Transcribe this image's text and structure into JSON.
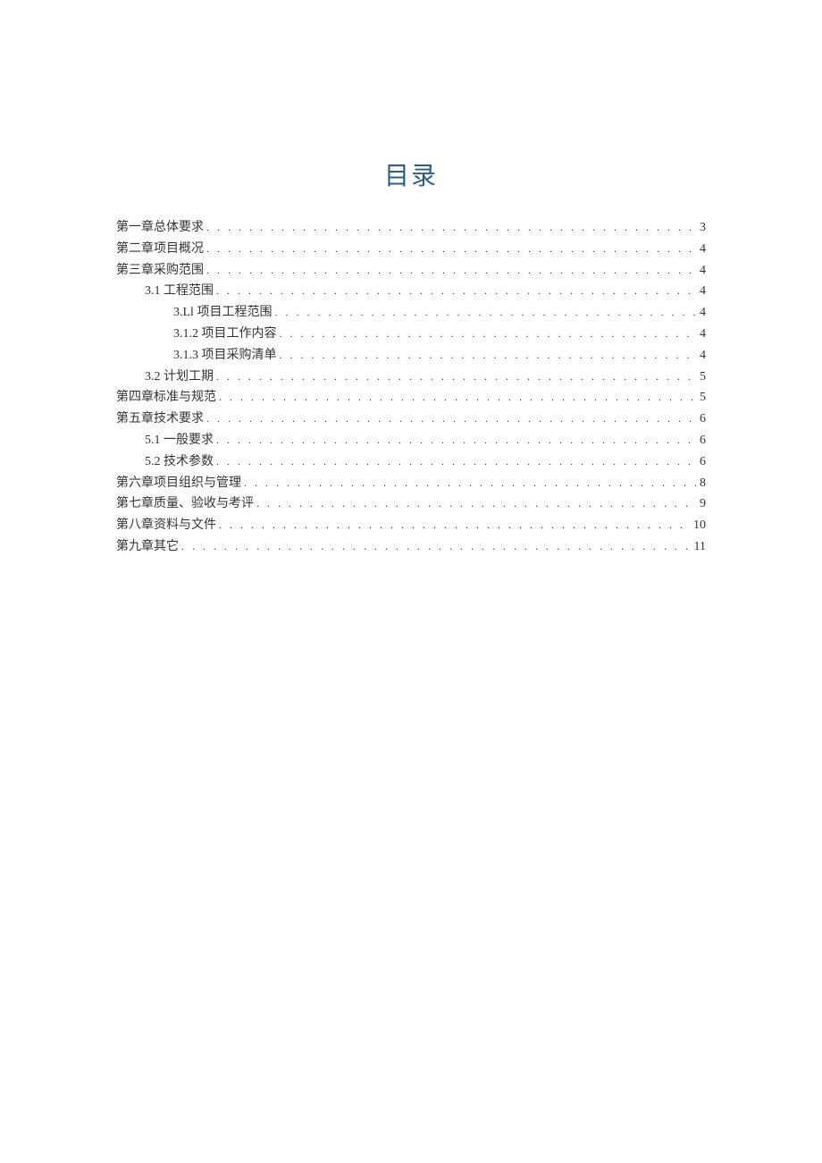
{
  "title": "目录",
  "entries": [
    {
      "label": "第一章总体要求",
      "page": "3",
      "level": 0
    },
    {
      "label": "第二章项目概况",
      "page": "4",
      "level": 0
    },
    {
      "label": "第三章采购范围",
      "page": "4",
      "level": 0
    },
    {
      "label": "3.1 工程范围",
      "page": "4",
      "level": 1
    },
    {
      "label": "3.Ll 项目工程范围",
      "page": "4",
      "level": 2
    },
    {
      "label": "3.1.2 项目工作内容",
      "page": "4",
      "level": 2
    },
    {
      "label": "3.1.3 项目采购清单",
      "page": "4",
      "level": 2
    },
    {
      "label": "3.2 计划工期",
      "page": "5",
      "level": 1
    },
    {
      "label": "第四章标准与规范",
      "page": "5",
      "level": 0
    },
    {
      "label": "第五章技术要求",
      "page": "6",
      "level": 0
    },
    {
      "label": "5.1 一般要求",
      "page": "6",
      "level": 1
    },
    {
      "label": "5.2 技术参数",
      "page": "6",
      "level": 1
    },
    {
      "label": "第六章项目组织与管理",
      "page": "8",
      "level": 0
    },
    {
      "label": "第七章质量、验收与考评",
      "page": "9",
      "level": 0
    },
    {
      "label": "第八章资料与文件",
      "page": "10",
      "level": 0
    },
    {
      "label": "第九章其它",
      "page": "11",
      "level": 0
    }
  ]
}
